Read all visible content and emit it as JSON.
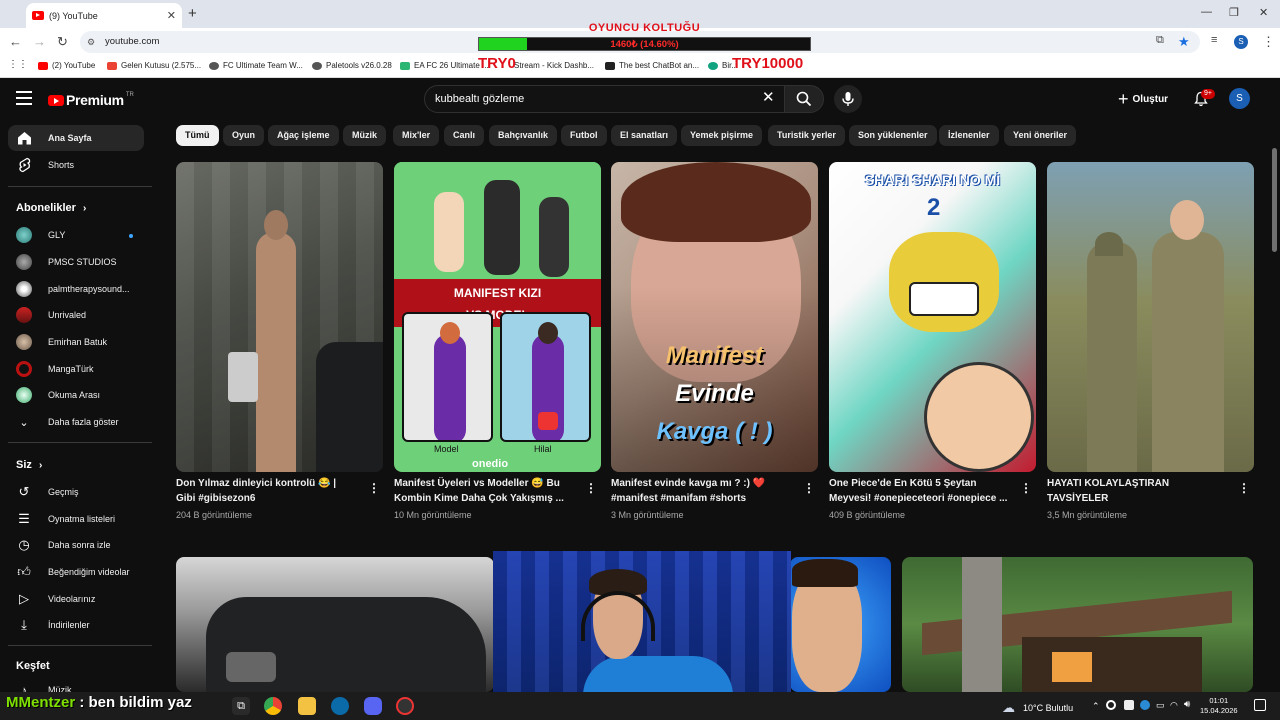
{
  "browser": {
    "tab_title": "(9) YouTube",
    "url": "youtube.com",
    "bookmarks": [
      {
        "label": "(2) YouTube"
      },
      {
        "label": "Gelen Kutusu (2.575..."
      },
      {
        "label": "FC Ultimate Team W..."
      },
      {
        "label": "Paletools v26.0.28"
      },
      {
        "label": "EA FC 26 Ultimate ..."
      },
      {
        "label": "Stream - Kick Dashb..."
      },
      {
        "label": "The best ChatBot an..."
      },
      {
        "label": "Bir..."
      }
    ]
  },
  "overlay": {
    "title": "OYUNCU KOLTUĞU",
    "progress_text": "1460₺ (14.60%)",
    "progress_fraction": 0.146,
    "min_label": "TRY0",
    "max_label": "TRY10000"
  },
  "header": {
    "logo": "Premium",
    "region": "TR",
    "search_value": "kubbealtı gözleme",
    "create_label": "Oluştur",
    "notif_count": "9+",
    "avatar_letter": "S"
  },
  "sidebar": {
    "main": [
      {
        "label": "Ana Sayfa",
        "icon": "home-icon"
      },
      {
        "label": "Shorts",
        "icon": "shorts-icon"
      }
    ],
    "subs_heading": "Abonelikler",
    "subs": [
      {
        "label": "GLY"
      },
      {
        "label": "PMSC STUDIOS"
      },
      {
        "label": "palmtherapysound..."
      },
      {
        "label": "Unrivaled"
      },
      {
        "label": "Emirhan Batuk"
      },
      {
        "label": "MangaTürk"
      },
      {
        "label": "Okuma Arası"
      },
      {
        "label": "Daha fazla göster"
      }
    ],
    "you_heading": "Siz",
    "you": [
      {
        "label": "Geçmiş"
      },
      {
        "label": "Oynatma listeleri"
      },
      {
        "label": "Daha sonra izle"
      },
      {
        "label": "Beğendiğim videolar"
      },
      {
        "label": "Videolarınız"
      },
      {
        "label": "İndirilenler"
      }
    ],
    "explore_heading": "Keşfet",
    "explore": [
      {
        "label": "Müzik"
      }
    ]
  },
  "chips": [
    "Tümü",
    "Oyun",
    "Ağaç işleme",
    "Müzik",
    "Mix'ler",
    "Canlı",
    "Bahçıvanlık",
    "Futbol",
    "El sanatları",
    "Yemek pişirme",
    "Turistik yerler",
    "Son yüklenenler",
    "İzlenenler",
    "Yeni öneriler"
  ],
  "videos": [
    {
      "title": "Don Yılmaz dinleyici kontrolü 😂 | Gibi #gibisezon6",
      "meta": "204 B görüntüleme"
    },
    {
      "title": "Manifest Üyeleri vs Modeller 😅 Bu Kombin Kime Daha Çok Yakışmış ...",
      "meta": "10 Mn görüntüleme",
      "thumb_top": "MANIFEST KIZI",
      "thumb_vs": "VS MODEL",
      "thumb_left": "Model",
      "thumb_right": "Hilal",
      "thumb_brand": "onedio"
    },
    {
      "title": "Manifest evinde kavga mı ? :) ❤️ #manifest #manifam #shorts",
      "meta": "3 Mn görüntüleme",
      "thumb_l1": "Manifest",
      "thumb_l2": "Evinde",
      "thumb_l3": "Kavga ( ! )"
    },
    {
      "title": "One Piece'de En Kötü 5 Şeytan Meyvesi! #onepieceteori #onepiece ...",
      "meta": "409 B görüntüleme",
      "thumb_top": "SHARI SHARI NO Mİ",
      "thumb_num": "2"
    },
    {
      "title": "HAYATI KOLAYLAŞTIRAN TAVSİYELER",
      "meta": "3,5 Mn görüntüleme"
    }
  ],
  "chat": {
    "user": "MMentzer",
    "message": " : ben bildim yaz"
  },
  "tray": {
    "weather": "10°C  Bulutlu",
    "time": "01:01",
    "date": "15.04.2026"
  },
  "colors": {
    "bg": "#0f0f0f",
    "chip": "#272727",
    "accent": "#ff0000",
    "overlay_red": "#e0101a",
    "overlay_green": "#1fd31f"
  }
}
